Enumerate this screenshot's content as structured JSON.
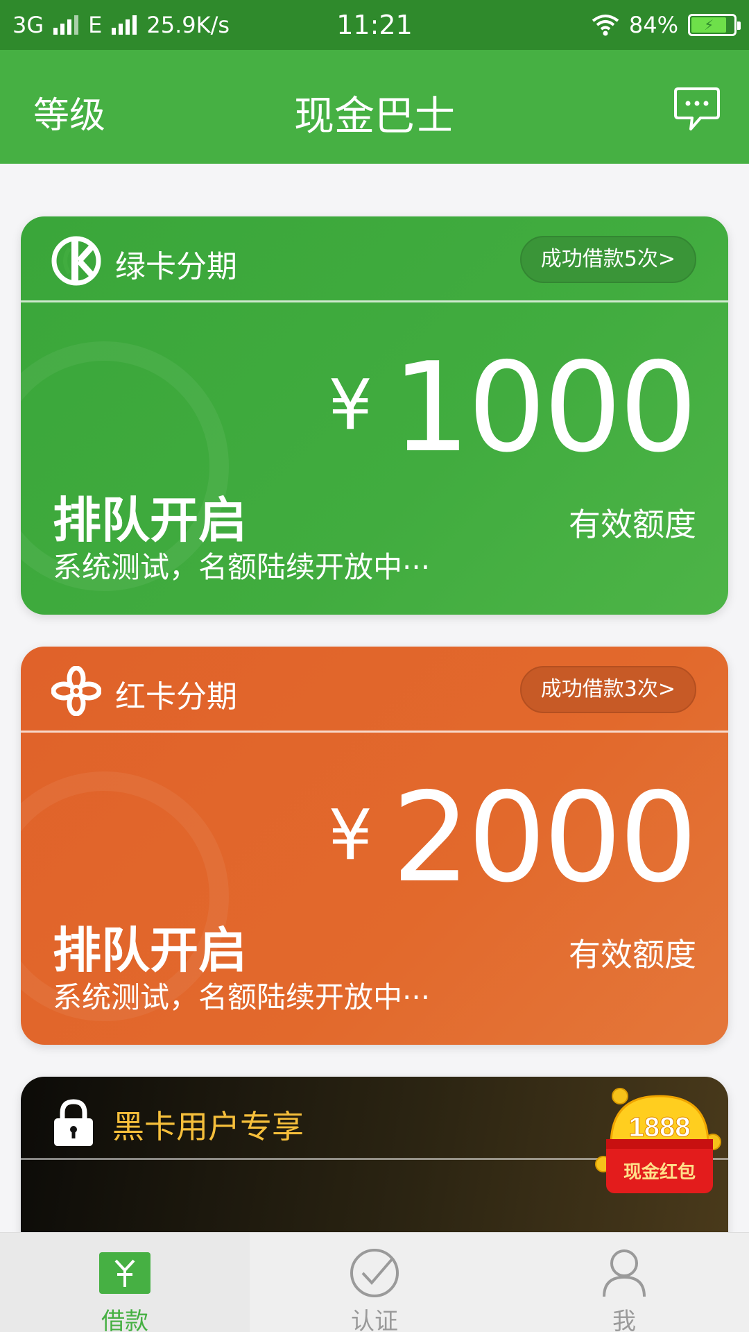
{
  "status_bar": {
    "network_1": "3G",
    "network_2": "E",
    "speed": "25.9K/s",
    "time": "11:21",
    "battery": "84%"
  },
  "header": {
    "left": "等级",
    "title": "现金巴士",
    "message_icon": "chat-bubble-icon"
  },
  "cards": [
    {
      "name": "绿卡分期",
      "badge": "成功借款5次>",
      "currency": "¥",
      "amount": "1000",
      "limit_label": "有效额度",
      "queue_title": "排队开启",
      "queue_sub": "系统测试，名额陆续开放中···",
      "color": "#41ac3f"
    },
    {
      "name": "红卡分期",
      "badge": "成功借款3次>",
      "currency": "¥",
      "amount": "2000",
      "limit_label": "有效额度",
      "queue_title": "排队开启",
      "queue_sub": "系统测试，名额陆续开放中···",
      "color": "#e2692c"
    }
  ],
  "black_card": {
    "name": "黑卡用户专享",
    "red_packet_amount": "1888",
    "red_packet_label": "现金红包"
  },
  "tabs": [
    {
      "label": "借款",
      "icon": "loan-icon",
      "active": true
    },
    {
      "label": "认证",
      "icon": "check-circle-icon",
      "active": false
    },
    {
      "label": "我",
      "icon": "person-icon",
      "active": false
    }
  ],
  "colors": {
    "primary_green": "#46b043",
    "status_green": "#2f8a2c",
    "orange": "#e2692c",
    "gold": "#f6bf3b"
  }
}
